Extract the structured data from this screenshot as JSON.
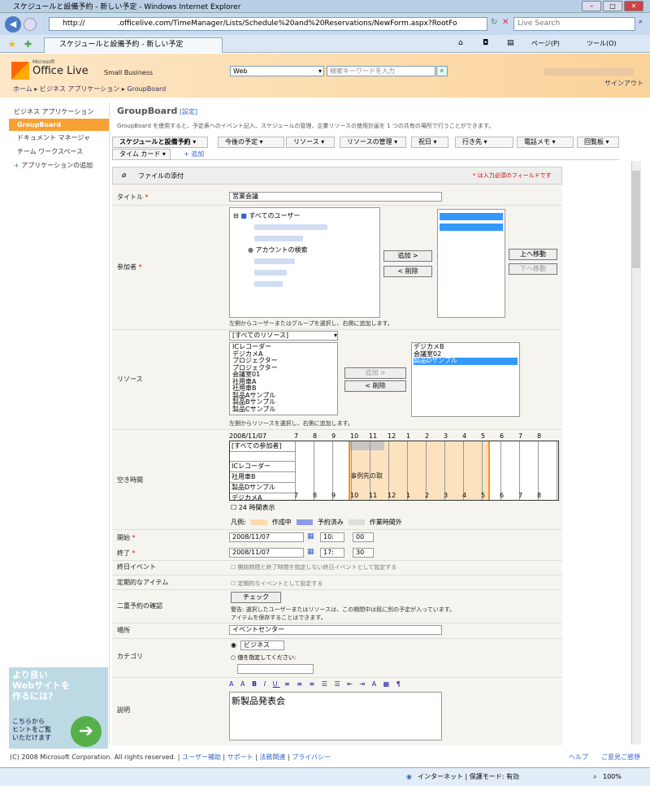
{
  "window": {
    "title": "スケジュールと設備予約 - 新しい予定 - Windows Internet Explorer",
    "url": "http://              .officelive.com/TimeManager/Lists/Schedule%20and%20Reservations/NewForm.aspx?RootFo",
    "search_placeholder": "Live Search",
    "tab_title": "スケジュールと設備予約 - 新しい予定",
    "toolbar": {
      "page": "ページ(P)",
      "tools": "ツール(O)"
    }
  },
  "header": {
    "logo_small": "Microsoft",
    "logo": "Office Live",
    "logo_suffix": "Small Business",
    "search_scope": "Web",
    "search_placeholder": "検索キーワードを入力",
    "signout": "サインアウト"
  },
  "breadcrumb": [
    "ホーム",
    "ビジネス アプリケーション",
    "GroupBoard"
  ],
  "leftnav": {
    "heading": "ビジネス アプリケーション",
    "items": [
      "GroupBoard",
      "ドキュメント マネージャ",
      "チーム ワークスペース"
    ],
    "add": "アプリケーションの追加"
  },
  "page": {
    "title": "GroupBoard",
    "settings": "[設定]",
    "description": "GroupBoard を使用すると、予定表へのイベント記入、スケジュールの管理、企業リソースの使用計画を 1 つの共有の場所で行うことができます。"
  },
  "menu": [
    "スケジュールと設備予約",
    "今後の予定",
    "リソース",
    "リソースの管理",
    "祝日",
    "行き先",
    "電話メモ",
    "回覧板",
    "タイム カード"
  ],
  "menu_add": "追加",
  "form": {
    "attach": "ファイルの添付",
    "required_note": "* は入力必須のフィールドです",
    "title_label": "タイトル",
    "title_value": "営業会議",
    "participants_label": "参加者",
    "tree_root": "すべてのユーザー",
    "account_search": "アカウントの検索",
    "add_btn": "追加 >",
    "remove_btn": "< 削除",
    "up_btn": "上へ移動",
    "down_btn": "下へ移動",
    "participants_note": "左側からユーザーまたはグループを選択し、右側に追加します。",
    "resource_label": "リソース",
    "resource_select": "[すべてのリソース]",
    "resources": [
      "ICレコーダー",
      "デジカメA",
      "プロジェクター",
      "プロジェクター",
      "会議室01",
      "社用車A",
      "社用車B",
      "製品Aサンプル",
      "製品Bサンプル",
      "製品Cサンプル"
    ],
    "resources_selected": [
      "デジカメB",
      "会議室02",
      "製品Dサンプル"
    ],
    "resource_add": "追加 >",
    "resource_remove": "< 削除",
    "resource_note": "左側からリソースを選択し、右側に追加します。",
    "free_label": "空き時間",
    "date": "2008/11/07",
    "hours": [
      "7",
      "8",
      "9",
      "10",
      "11",
      "12",
      "1",
      "2",
      "3",
      "4",
      "5",
      "6",
      "7",
      "8"
    ],
    "grid_rows": [
      "[すべての参加者]",
      "",
      "ICレコーダー",
      "社用車B",
      "製品Dサンプル",
      "デジカメA"
    ],
    "grid_event": "事例先の取",
    "show24": "24 時間表示",
    "legend_label": "凡例:",
    "legend": [
      "作成中",
      "予約済み",
      "作業時間外"
    ],
    "start_label": "開始",
    "start_date": "2008/11/07",
    "start_h": "10:",
    "start_m": "00",
    "end_label": "終了",
    "end_date": "2008/11/07",
    "end_h": "17:",
    "end_m": "30",
    "allday_label": "終日イベント",
    "allday_text": "開始時間と終了時間を指定しない終日イベントとして設定する",
    "recur_label": "定期的なアイテム",
    "recur_text": "定期的なイベントとして設定する",
    "dup_label": "二重予約の確認",
    "check_btn": "チェック",
    "dup_warn": "警告: 選択したユーザーまたはリソースは、この期間中は既に別の予定が入っています。アイテムを保存することはできます。",
    "place_label": "場所",
    "place_value": "イベントセンター",
    "cat_label": "カテゴリ",
    "cat_value": "ビジネス",
    "cat_other": "値を指定してください:",
    "desc_label": "説明",
    "desc_value": "新製品発表会"
  },
  "ad": {
    "line1": "より良い",
    "line2": "Webサイトを",
    "line3": "作るには?",
    "line4": "こちらから",
    "line5": "ヒントをご覧",
    "line6": "いただけます"
  },
  "footer": {
    "copyright": "(C) 2008 Microsoft Corporation. All rights reserved.",
    "links": [
      "ユーザー補助",
      "サポート",
      "法務関連",
      "プライバシー"
    ],
    "help": "ヘルプ",
    "feedback": "ご意見ご感想"
  },
  "status": {
    "zone": "インターネット | 保護モード: 有効",
    "zoom": "100%"
  }
}
